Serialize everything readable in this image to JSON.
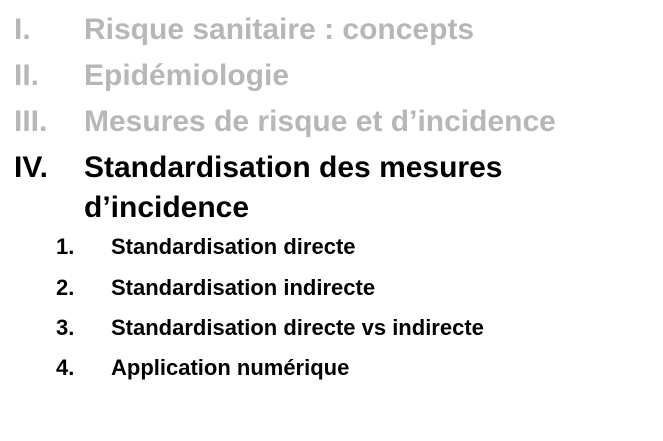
{
  "outline": {
    "items": [
      {
        "number": "I.",
        "label": "Risque sanitaire : concepts",
        "state": "dimmed"
      },
      {
        "number": "II.",
        "label": "Epidémiologie",
        "state": "dimmed"
      },
      {
        "number": "III.",
        "label": "Mesures de risque et d’incidence",
        "state": "dimmed"
      },
      {
        "number": "IV.",
        "label_line1": "Standardisation des mesures",
        "label_line2": "d’incidence",
        "state": "active"
      }
    ],
    "subitems": [
      {
        "number": "1.",
        "label": "Standardisation directe"
      },
      {
        "number": "2.",
        "label": "Standardisation indirecte"
      },
      {
        "number": "3.",
        "label": "Standardisation directe vs indirecte"
      },
      {
        "number": "4.",
        "label": "Application numérique"
      }
    ]
  },
  "colors": {
    "dimmed_text": "#b7b7b7",
    "active_text": "#000000",
    "background": "#ffffff"
  }
}
